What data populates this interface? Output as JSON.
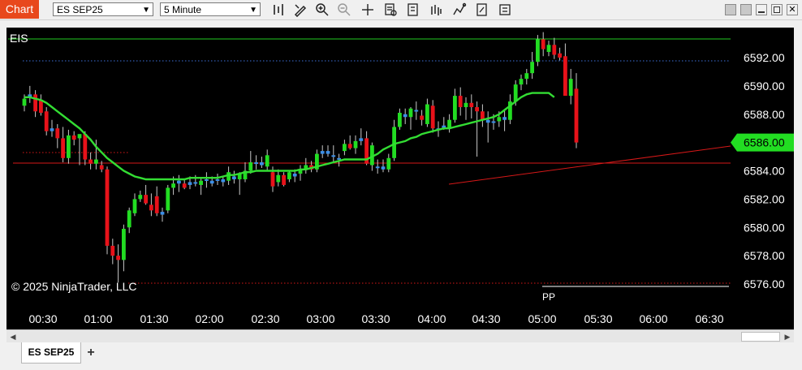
{
  "toolbar": {
    "chart_tab_label": "Chart",
    "instrument": "ES SEP25",
    "interval": "5 Minute",
    "icons": [
      "bar-type-icon",
      "drawing-tool-icon",
      "zoom-in-icon",
      "zoom-out-icon",
      "crosshair-icon",
      "data-box-icon",
      "templates-icon",
      "indicators-icon",
      "strategies-icon",
      "properties-icon",
      "chart-trader-icon"
    ],
    "window_buttons": [
      "window-option-icon",
      "window-settings-icon",
      "minimize-icon",
      "maximize-icon",
      "close-icon"
    ]
  },
  "chart_data": {
    "type": "candlestick",
    "instrument_label": "EIS",
    "watermark": "© 2025 NinjaTrader, LLC",
    "pivot_label": "PP",
    "ylim": [
      6575.0,
      6597.0
    ],
    "yticks": [
      6576,
      6578,
      6580,
      6582,
      6584,
      6586,
      6588,
      6590,
      6592
    ],
    "ytick_labels": [
      "6576.00",
      "6578.00",
      "6580.00",
      "6582.00",
      "6584.00",
      "6586.00",
      "6588.00",
      "6590.00",
      "6592.00"
    ],
    "xticks": [
      "00:30",
      "01:00",
      "01:30",
      "02:00",
      "02:30",
      "03:00",
      "03:30",
      "04:00",
      "04:30",
      "05:00",
      "05:30",
      "06:00",
      "06:30"
    ],
    "last_price": "6586.00",
    "levels": {
      "upper_line": 6594.3,
      "dotted_blue": 6592.0,
      "session_high": 6592.0,
      "horizontal_red": 6584.6,
      "low_dotted": 6576.0,
      "upper_dotted_red": 6585.4
    },
    "trendline": {
      "from_bar": 60,
      "from_price": 6583.2,
      "to_bar": 98,
      "to_price": 6585.8
    },
    "colors": {
      "up": "#22dd22",
      "down": "#e8121a",
      "doji_up": "#3b8fe8",
      "doji_down": "#3b8fe8",
      "sma": "#33dd33",
      "grid_line_green": "#22cc22",
      "red_line": "#d61818",
      "accent": "#e8481c"
    },
    "bars": [
      [
        6588.6,
        6589.4,
        6588.2,
        6589.1
      ],
      [
        6589.2,
        6590.0,
        6588.8,
        6589.4
      ],
      [
        6589.4,
        6589.7,
        6587.8,
        6588.2
      ],
      [
        6589.0,
        6589.4,
        6587.9,
        6588.1
      ],
      [
        6588.2,
        6588.5,
        6586.5,
        6586.8
      ],
      [
        6586.8,
        6587.6,
        6586.4,
        6587.0
      ],
      [
        6587.0,
        6587.3,
        6585.6,
        6586.3
      ],
      [
        6586.3,
        6587.1,
        6584.6,
        6584.9
      ],
      [
        6584.9,
        6586.9,
        6584.5,
        6586.5
      ],
      [
        6586.5,
        6586.8,
        6585.8,
        6586.2
      ],
      [
        6586.3,
        6586.5,
        6584.4,
        6586.6
      ],
      [
        6586.6,
        6586.8,
        6584.4,
        6584.8
      ],
      [
        6584.8,
        6585.3,
        6584.1,
        6584.5
      ],
      [
        6584.5,
        6586.2,
        6584.1,
        6584.8
      ],
      [
        6584.4,
        6584.7,
        6583.9,
        6584.1
      ],
      [
        6584.1,
        6584.3,
        6578.1,
        6578.7
      ],
      [
        6578.7,
        6579.2,
        6577.4,
        6578.0
      ],
      [
        6578.0,
        6578.8,
        6576.1,
        6577.7
      ],
      [
        6577.7,
        6580.2,
        6576.9,
        6579.9
      ],
      [
        6580.0,
        6581.4,
        6579.6,
        6581.2
      ],
      [
        6581.0,
        6582.4,
        6580.8,
        6582.0
      ],
      [
        6582.0,
        6582.6,
        6581.8,
        6582.3
      ],
      [
        6582.3,
        6583.0,
        6581.6,
        6581.7
      ],
      [
        6581.6,
        6582.4,
        6580.8,
        6581.2
      ],
      [
        6582.2,
        6582.9,
        6580.8,
        6581.0
      ],
      [
        6580.9,
        6581.4,
        6580.4,
        6581.1
      ],
      [
        6581.2,
        6583.0,
        6581.0,
        6582.8
      ],
      [
        6582.8,
        6583.6,
        6582.3,
        6583.1
      ],
      [
        6583.1,
        6583.7,
        6582.5,
        6583.3
      ],
      [
        6583.1,
        6583.4,
        6582.7,
        6582.8
      ],
      [
        6583.0,
        6583.6,
        6582.7,
        6583.2
      ],
      [
        6583.2,
        6583.7,
        6582.9,
        6583.1
      ],
      [
        6583.0,
        6583.5,
        6582.3,
        6583.3
      ],
      [
        6583.3,
        6583.9,
        6582.8,
        6583.4
      ],
      [
        6583.1,
        6583.6,
        6582.9,
        6583.3
      ],
      [
        6583.3,
        6583.8,
        6583.0,
        6583.4
      ],
      [
        6583.4,
        6583.6,
        6582.9,
        6583.2
      ],
      [
        6583.3,
        6584.3,
        6583.0,
        6583.9
      ],
      [
        6583.6,
        6584.0,
        6583.1,
        6583.4
      ],
      [
        6583.4,
        6583.9,
        6582.3,
        6583.8
      ],
      [
        6583.4,
        6584.6,
        6583.2,
        6584.0
      ],
      [
        6584.0,
        6585.4,
        6583.8,
        6584.6
      ],
      [
        6584.5,
        6585.1,
        6584.1,
        6584.6
      ],
      [
        6584.6,
        6585.0,
        6584.2,
        6584.4
      ],
      [
        6584.3,
        6585.5,
        6584.0,
        6585.1
      ],
      [
        6583.9,
        6584.3,
        6582.5,
        6582.9
      ],
      [
        6583.2,
        6584.1,
        6582.9,
        6583.7
      ],
      [
        6583.7,
        6583.9,
        6582.9,
        6583.0
      ],
      [
        6583.4,
        6584.0,
        6583.2,
        6583.9
      ],
      [
        6583.6,
        6584.1,
        6583.2,
        6583.8
      ],
      [
        6583.8,
        6584.4,
        6583.3,
        6584.1
      ],
      [
        6584.1,
        6584.9,
        6583.8,
        6584.4
      ],
      [
        6584.4,
        6584.7,
        6583.9,
        6584.1
      ],
      [
        6584.1,
        6585.5,
        6583.9,
        6585.2
      ],
      [
        6585.2,
        6585.8,
        6584.9,
        6585.4
      ],
      [
        6585.4,
        6585.8,
        6585.0,
        6585.2
      ],
      [
        6585.0,
        6585.8,
        6584.6,
        6585.1
      ],
      [
        6584.8,
        6585.2,
        6584.3,
        6584.9
      ],
      [
        6585.4,
        6586.2,
        6585.1,
        6585.9
      ],
      [
        6585.9,
        6586.5,
        6585.5,
        6585.6
      ],
      [
        6585.6,
        6586.5,
        6585.2,
        6586.1
      ],
      [
        6586.1,
        6587.0,
        6585.8,
        6586.3
      ],
      [
        6586.3,
        6586.8,
        6584.4,
        6584.5
      ],
      [
        6584.4,
        6586.0,
        6584.0,
        6585.8
      ],
      [
        6584.2,
        6584.8,
        6583.8,
        6584.3
      ],
      [
        6584.3,
        6584.8,
        6583.9,
        6584.1
      ],
      [
        6584.1,
        6585.2,
        6583.9,
        6584.9
      ],
      [
        6584.9,
        6587.6,
        6584.7,
        6587.1
      ],
      [
        6587.1,
        6588.4,
        6586.9,
        6588.1
      ],
      [
        6588.0,
        6588.4,
        6587.3,
        6587.8
      ],
      [
        6587.8,
        6588.5,
        6586.9,
        6588.4
      ],
      [
        6588.3,
        6588.9,
        6587.6,
        6588.2
      ],
      [
        6587.9,
        6588.3,
        6587.2,
        6587.6
      ],
      [
        6587.3,
        6589.1,
        6587.1,
        6588.7
      ],
      [
        6588.6,
        6589.0,
        6586.7,
        6587.0
      ],
      [
        6587.0,
        6587.5,
        6586.4,
        6586.9
      ],
      [
        6587.2,
        6587.8,
        6586.9,
        6587.0
      ],
      [
        6587.0,
        6588.0,
        6586.7,
        6587.6
      ],
      [
        6587.6,
        6589.8,
        6587.4,
        6589.3
      ],
      [
        6589.3,
        6589.9,
        6587.9,
        6588.5
      ],
      [
        6588.5,
        6589.2,
        6587.6,
        6588.8
      ],
      [
        6588.8,
        6589.4,
        6587.7,
        6588.5
      ],
      [
        6588.5,
        6588.9,
        6585.0,
        6588.2
      ],
      [
        6588.2,
        6588.7,
        6587.1,
        6587.6
      ],
      [
        6587.6,
        6588.2,
        6586.0,
        6587.4
      ],
      [
        6587.4,
        6588.0,
        6586.9,
        6587.5
      ],
      [
        6587.5,
        6588.2,
        6587.1,
        6587.8
      ],
      [
        6587.8,
        6588.3,
        6586.8,
        6587.6
      ],
      [
        6587.6,
        6589.4,
        6587.3,
        6588.9
      ],
      [
        6588.9,
        6590.4,
        6588.6,
        6590.1
      ],
      [
        6590.1,
        6590.8,
        6589.7,
        6590.5
      ],
      [
        6590.5,
        6591.2,
        6590.1,
        6590.9
      ],
      [
        6590.9,
        6592.4,
        6590.5,
        6591.7
      ],
      [
        6591.7,
        6593.6,
        6591.4,
        6593.3
      ],
      [
        6593.3,
        6593.8,
        6592.1,
        6592.6
      ],
      [
        6592.4,
        6593.2,
        6592.1,
        6592.9
      ],
      [
        6592.9,
        6593.4,
        6591.9,
        6592.2
      ],
      [
        6592.3,
        6592.7,
        6591.8,
        6592.0
      ],
      [
        6592.1,
        6593.0,
        6591.6,
        6589.3
      ],
      [
        6589.3,
        6591.2,
        6588.7,
        6590.5
      ],
      [
        6589.8,
        6590.9,
        6585.6,
        6586.0
      ]
    ],
    "sma": [
      6589.2,
      6589.2,
      6589.1,
      6589.0,
      6588.8,
      6588.5,
      6588.2,
      6587.9,
      6587.6,
      6587.3,
      6587.0,
      6586.6,
      6586.2,
      6585.7,
      6585.3,
      6584.9,
      6584.6,
      6584.3,
      6584.0,
      6583.8,
      6583.6,
      6583.5,
      6583.4,
      6583.4,
      6583.4,
      6583.4,
      6583.4,
      6583.4,
      6583.4,
      6583.4,
      6583.5,
      6583.5,
      6583.5,
      6583.5,
      6583.5,
      6583.5,
      6583.6,
      6583.7,
      6583.7,
      6583.8,
      6583.9,
      6583.9,
      6584.0,
      6584.0,
      6584.0,
      6584.0,
      6584.0,
      6584.0,
      6584.0,
      6584.0,
      6584.1,
      6584.1,
      6584.2,
      6584.3,
      6584.4,
      6584.5,
      6584.6,
      6584.7,
      6584.8,
      6584.8,
      6584.8,
      6584.8,
      6584.8,
      6585.0,
      6585.2,
      6585.5,
      6585.7,
      6585.9,
      6586.0,
      6586.1,
      6586.3,
      6586.4,
      6586.6,
      6586.7,
      6586.8,
      6586.9,
      6587.0,
      6587.0,
      6587.1,
      6587.2,
      6587.3,
      6587.4,
      6587.5,
      6587.6,
      6587.7,
      6587.8,
      6588.0,
      6588.3,
      6588.6,
      6588.9,
      6589.2,
      6589.4,
      6589.5,
      6589.5,
      6589.5,
      6589.5,
      6589.2
    ]
  }
}
